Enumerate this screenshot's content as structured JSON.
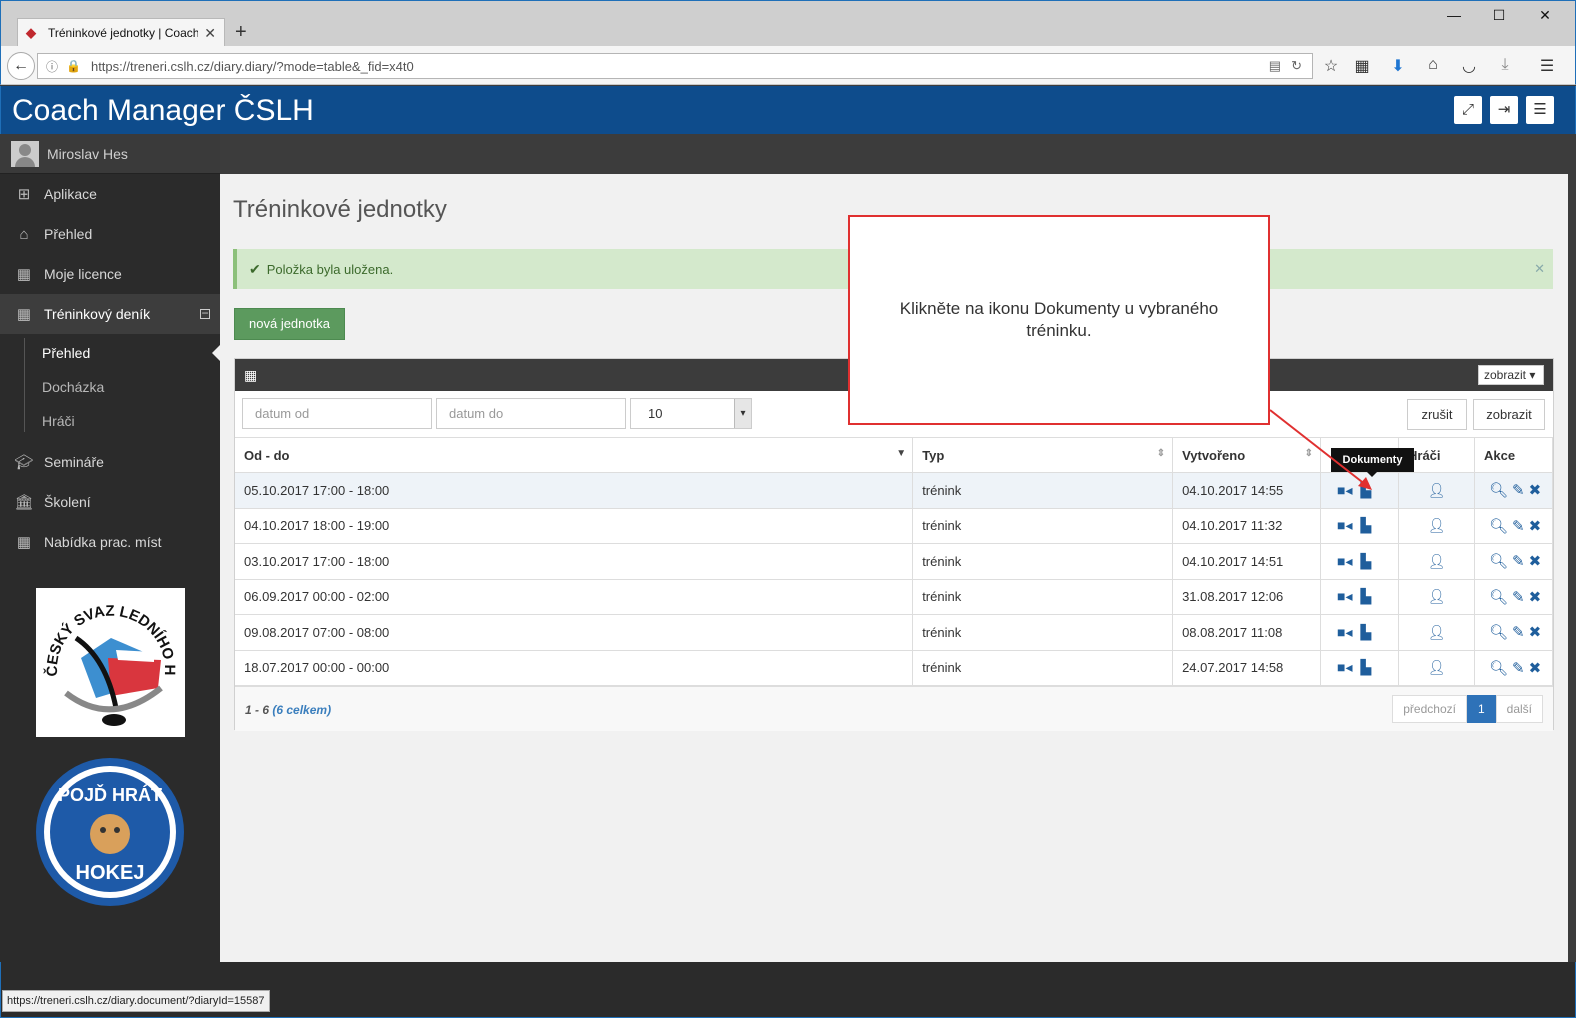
{
  "browser": {
    "tab_title": "Tréninkové jednotky | Coach",
    "url": "https://treneri.cslh.cz/diary.diary/?mode=table&_fid=x4t0",
    "status_url": "https://treneri.cslh.cz/diary.document/?diaryId=15587"
  },
  "app": {
    "title": "Coach Manager ČSLH"
  },
  "sidebar": {
    "username": "Miroslav Hes",
    "items": [
      {
        "label": "Aplikace",
        "icon": "sitemap-icon"
      },
      {
        "label": "Přehled",
        "icon": "home-icon"
      },
      {
        "label": "Moje licence",
        "icon": "table-icon"
      },
      {
        "label": "Tréninkový deník",
        "icon": "table-icon"
      },
      {
        "label": "Semináře",
        "icon": "graduation-cap-icon"
      },
      {
        "label": "Školení",
        "icon": "bank-icon"
      },
      {
        "label": "Nabídka prac. míst",
        "icon": "table-icon"
      }
    ],
    "subitems": [
      "Přehled",
      "Docházka",
      "Hráči"
    ],
    "logo1_text": "ČESKÝ SVAZ LEDNÍHO HOKEJE",
    "logo2_text_top": "POJĎ HRÁT",
    "logo2_text_bottom": "HOKEJ"
  },
  "page": {
    "title": "Tréninkové jednotky",
    "alert": "Položka byla uložena.",
    "new_button": "nová jednotka"
  },
  "panel": {
    "view_dropdown": "zobrazit",
    "filter_from_placeholder": "datum od",
    "filter_to_placeholder": "datum do",
    "page_size": "10",
    "clear_button": "zrušit",
    "show_button": "zobrazit",
    "columns": [
      "Od - do",
      "Typ",
      "Vytvořeno",
      "",
      "Hráči",
      "Akce"
    ],
    "rows": [
      {
        "range": "05.10.2017 17:00 - 18:00",
        "type": "trénink",
        "created": "04.10.2017 14:55"
      },
      {
        "range": "04.10.2017 18:00 - 19:00",
        "type": "trénink",
        "created": "04.10.2017 11:32"
      },
      {
        "range": "03.10.2017 17:00 - 18:00",
        "type": "trénink",
        "created": "04.10.2017 14:51"
      },
      {
        "range": "06.09.2017 00:00 - 02:00",
        "type": "trénink",
        "created": "31.08.2017 12:06"
      },
      {
        "range": "09.08.2017 07:00 - 08:00",
        "type": "trénink",
        "created": "08.08.2017 11:08"
      },
      {
        "range": "18.07.2017 00:00 - 00:00",
        "type": "trénink",
        "created": "24.07.2017 14:58"
      }
    ],
    "count_range": "1 - 6",
    "count_total": "(6 celkem)",
    "pager": {
      "prev": "předchozí",
      "page": "1",
      "next": "další"
    }
  },
  "tooltip": "Dokumenty",
  "callout": "Klikněte na ikonu Dokumenty u vybraného tréninku.",
  "colors": {
    "header": "#0e4c8c",
    "sidebar": "#2b2b2b",
    "accent_icon": "#1f5e9c",
    "callout_border": "#e03030",
    "new_button": "#5c9a5e"
  }
}
